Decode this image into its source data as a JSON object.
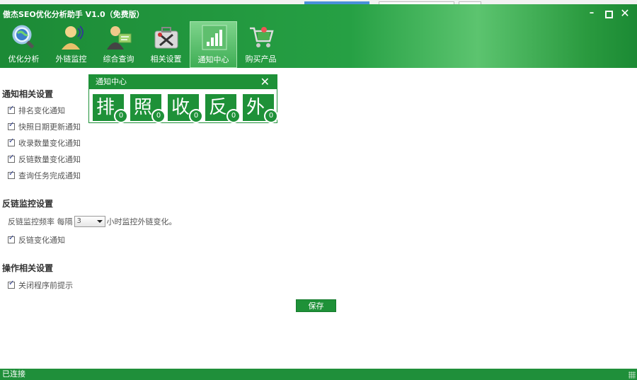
{
  "window": {
    "title": "傲杰SEO优化分析助手 V1.0（免费版）"
  },
  "window_controls": {
    "minimize": "–",
    "close": "✕"
  },
  "nav": {
    "items": [
      {
        "label": "优化分析",
        "icon": "magnifier-globe-icon"
      },
      {
        "label": "外链监控",
        "icon": "headset-person-icon"
      },
      {
        "label": "综合查询",
        "icon": "person-card-icon"
      },
      {
        "label": "相关设置",
        "icon": "toolbox-icon"
      },
      {
        "label": "通知中心",
        "icon": "equalizer-icon",
        "active": true
      },
      {
        "label": "购买产品",
        "icon": "shopping-cart-icon"
      }
    ]
  },
  "notify_settings": {
    "title": "通知相关设置",
    "options": [
      {
        "label": "排名变化通知",
        "checked": true
      },
      {
        "label": "快照日期更新通知",
        "checked": true
      },
      {
        "label": "收录数量变化通知",
        "checked": true
      },
      {
        "label": "反链数量变化通知",
        "checked": true
      },
      {
        "label": "查询任务完成通知",
        "checked": true
      }
    ]
  },
  "backlink_settings": {
    "title": "反链监控设置",
    "freq_prefix": "反链监控频率 每隔",
    "freq_value": "3",
    "freq_suffix": "小时监控外链变化。",
    "option": {
      "label": "反链变化通知",
      "checked": true
    }
  },
  "operation_settings": {
    "title": "操作相关设置",
    "option": {
      "label": "关闭程序前提示",
      "checked": true
    }
  },
  "save_button": {
    "label": "保存"
  },
  "status_bar": {
    "text": "已连接"
  },
  "popup": {
    "title": "通知中心",
    "close": "✕",
    "tiles": [
      {
        "char": "排",
        "count": "0"
      },
      {
        "char": "照",
        "count": "0"
      },
      {
        "char": "收",
        "count": "0"
      },
      {
        "char": "反",
        "count": "0"
      },
      {
        "char": "外",
        "count": "0"
      }
    ]
  },
  "colors": {
    "primary_green": "#1e9138",
    "header_light": "#5cc46f"
  }
}
